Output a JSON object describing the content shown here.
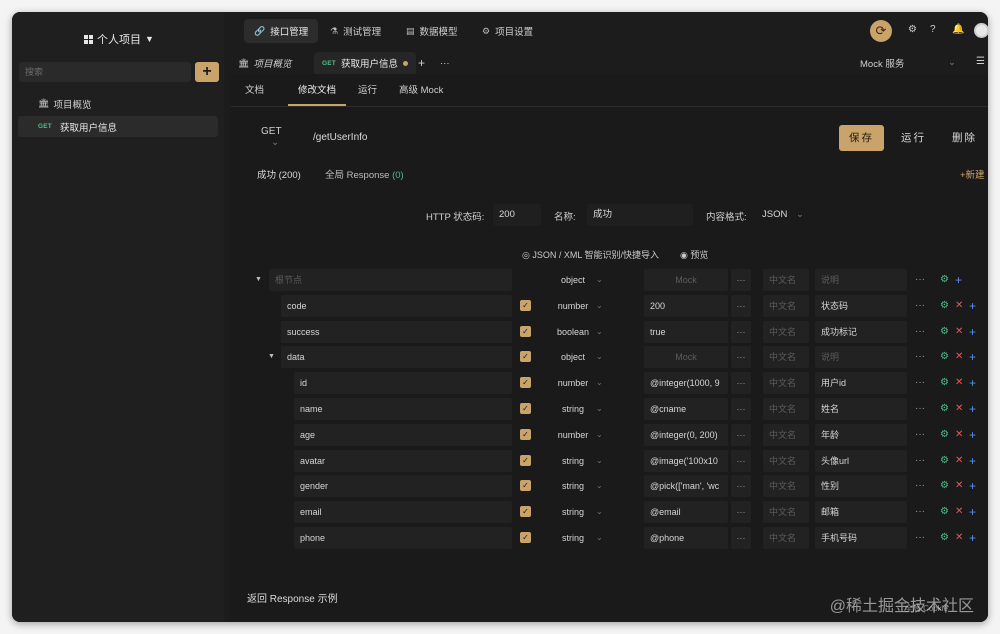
{
  "sidebar": {
    "project_title": "个人项目",
    "search_placeholder": "搜索",
    "add_label": "+",
    "items": [
      {
        "label": "项目概览",
        "tag": ""
      },
      {
        "label": "获取用户信息",
        "tag": "GET"
      }
    ]
  },
  "topnav": {
    "tabs": [
      {
        "label": "接口管理"
      },
      {
        "label": "测试管理"
      },
      {
        "label": "数据模型"
      },
      {
        "label": "项目设置"
      }
    ]
  },
  "doc_tabs": {
    "overview": "项目概览",
    "method": "GET",
    "current": "获取用户信息",
    "add": "+",
    "more": "···",
    "mock_service": "Mock 服务"
  },
  "subtabs": [
    "文档",
    "修改文档",
    "运行",
    "高级 Mock"
  ],
  "request": {
    "method": "GET",
    "url": "/getUserInfo",
    "save": "保存",
    "run": "运行",
    "delete": "删除"
  },
  "responses": {
    "success_tab": "成功 (200)",
    "global_tab": "全局 Response",
    "global_count": "(0)",
    "new_link": "+新建"
  },
  "meta": {
    "status_label": "HTTP 状态码:",
    "status_value": "200",
    "name_label": "名称:",
    "name_value": "成功",
    "format_label": "内容格式:",
    "format_value": "JSON"
  },
  "json_tools": {
    "import_label": "JSON / XML 智能识别/快捷导入",
    "preview_label": "预览"
  },
  "placeholders": {
    "root": "根节点",
    "mock": "Mock",
    "cn_name": "中文名",
    "desc": "说明"
  },
  "schema_rows": [
    {
      "name": "",
      "type": "object",
      "mock": "",
      "desc": ""
    },
    {
      "name": "code",
      "type": "number",
      "mock": "200",
      "desc": "状态码"
    },
    {
      "name": "success",
      "type": "boolean",
      "mock": "true",
      "desc": "成功标记"
    },
    {
      "name": "data",
      "type": "object",
      "mock": "",
      "desc": ""
    },
    {
      "name": "id",
      "type": "number",
      "mock": "@integer(1000, 9",
      "desc": "用户id"
    },
    {
      "name": "name",
      "type": "string",
      "mock": "@cname",
      "desc": "姓名"
    },
    {
      "name": "age",
      "type": "number",
      "mock": "@integer(0, 200)",
      "desc": "年龄"
    },
    {
      "name": "avatar",
      "type": "string",
      "mock": "@image('100x10",
      "desc": "头像url"
    },
    {
      "name": "gender",
      "type": "string",
      "mock": "@pick(['man', 'wc",
      "desc": "性别"
    },
    {
      "name": "email",
      "type": "string",
      "mock": "@email",
      "desc": "邮箱"
    },
    {
      "name": "phone",
      "type": "string",
      "mock": "@phone",
      "desc": "手机号码"
    }
  ],
  "footer": {
    "response_example": "返回 Response 示例",
    "watermark": "@稀土掘金技术社区",
    "cookie": "全局 Cookie"
  },
  "colors": {
    "accent": "#c9a36a",
    "success": "#4fbf8b",
    "danger": "#e05a5a",
    "info": "#5b8def"
  }
}
